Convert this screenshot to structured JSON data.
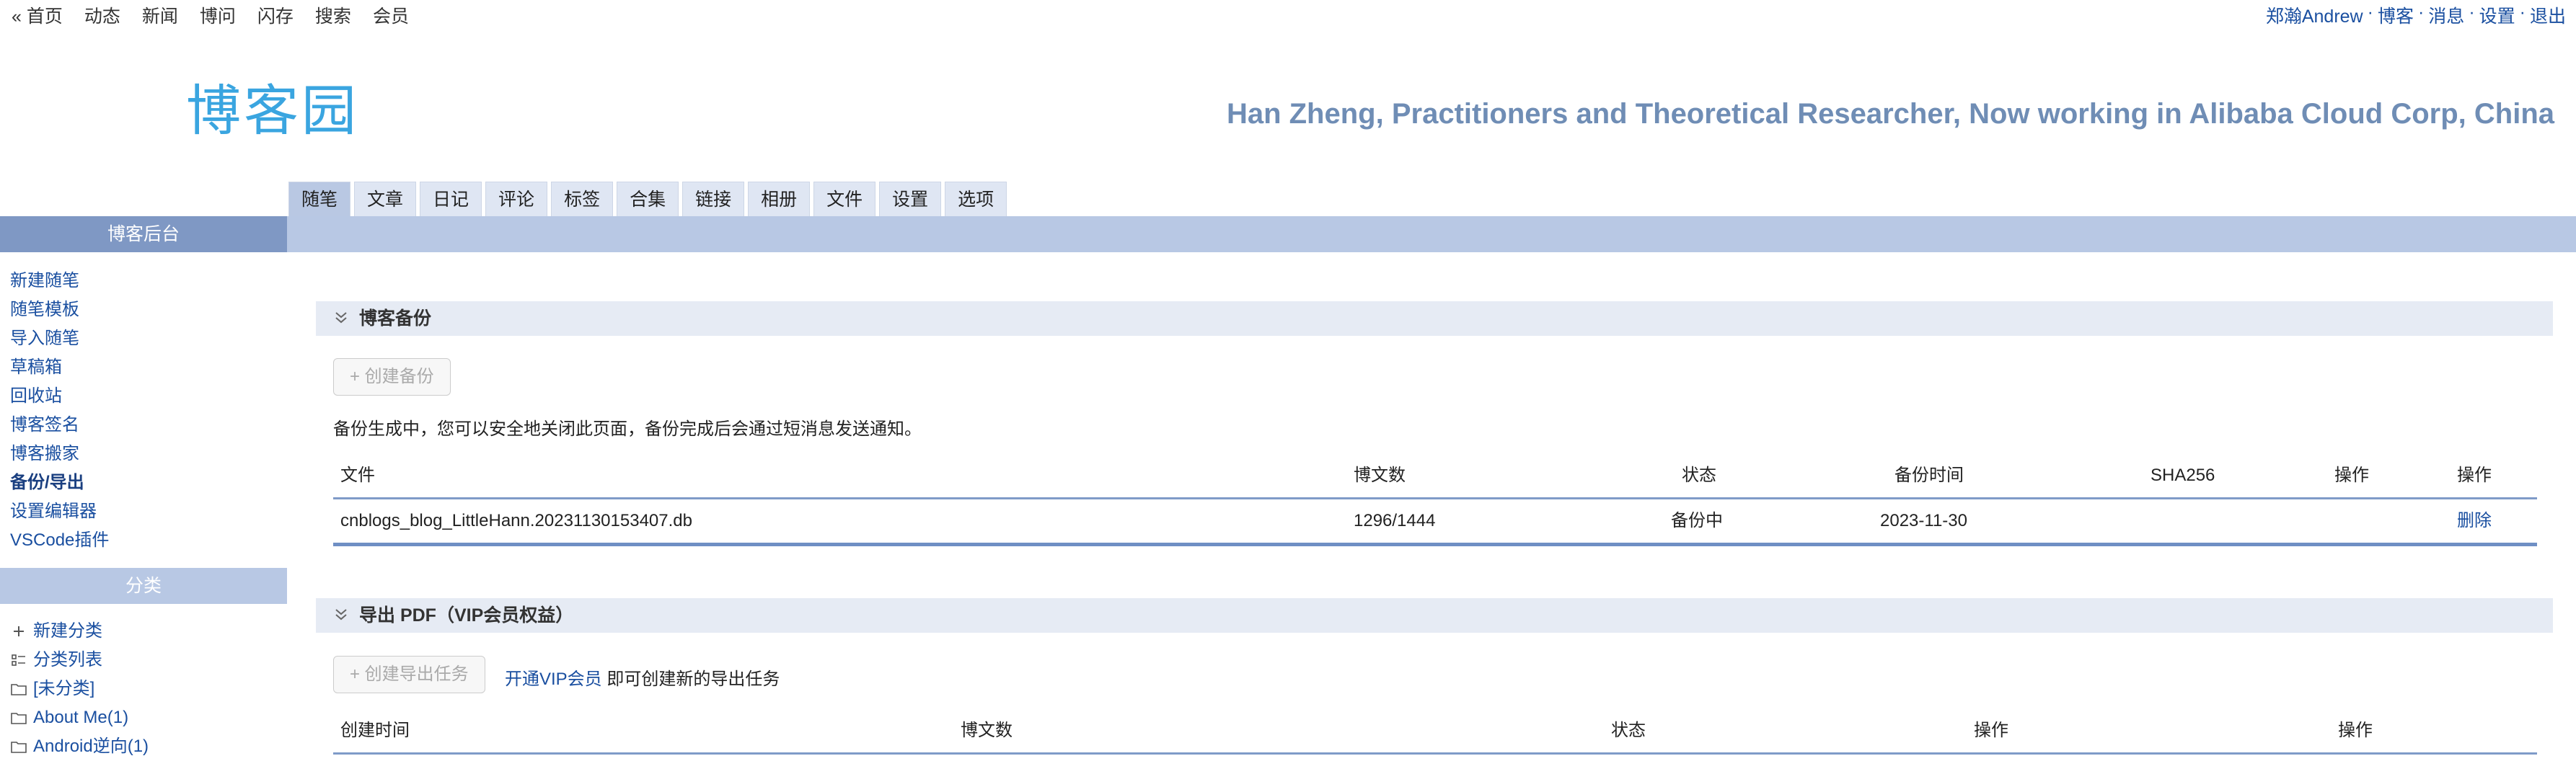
{
  "topnav": {
    "left": [
      "« 首页",
      "动态",
      "新闻",
      "博问",
      "闪存",
      "搜索",
      "会员"
    ],
    "right": [
      "郑瀚Andrew",
      "博客",
      "消息",
      "设置",
      "退出"
    ],
    "separator": "·"
  },
  "logo": {
    "text": "博客园",
    "color": "#3aa5e0"
  },
  "header": {
    "blog_title": "Han Zheng, Practitioners and Theoretical Researcher, Now working in Alibaba Cloud Corp, China"
  },
  "tabs": [
    "随笔",
    "文章",
    "日记",
    "评论",
    "标签",
    "合集",
    "链接",
    "相册",
    "文件",
    "设置",
    "选项"
  ],
  "sidebar": {
    "title": "博客后台",
    "items": [
      "新建随笔",
      "随笔模板",
      "导入随笔",
      "草稿箱",
      "回收站",
      "博客签名",
      "博客搬家",
      "备份/导出",
      "设置编辑器",
      "VSCode插件"
    ],
    "active_item": "备份/导出",
    "category_title": "分类",
    "categories": [
      {
        "icon": "plus-icon",
        "label": "新建分类"
      },
      {
        "icon": "list-icon",
        "label": "分类列表"
      },
      {
        "icon": "folder-icon",
        "label": "[未分类]"
      },
      {
        "icon": "folder-icon",
        "label": "About Me(1)"
      },
      {
        "icon": "folder-icon",
        "label": "Android逆向(1)"
      }
    ]
  },
  "backup": {
    "title": "博客备份",
    "create_button": "+ 创建备份",
    "message": "备份生成中，您可以安全地关闭此页面，备份完成后会通过短消息发送通知。",
    "columns": [
      "文件",
      "博文数",
      "状态",
      "备份时间",
      "SHA256",
      "操作",
      "操作"
    ],
    "rows": [
      {
        "file": "cnblogs_blog_LittleHann.20231130153407.db",
        "count": "1296/1444",
        "status": "备份中",
        "time": "2023-11-30",
        "sha256": "",
        "op1": "",
        "op2": "删除"
      }
    ]
  },
  "pdf": {
    "title": "导出 PDF（VIP会员权益）",
    "create_button": "+ 创建导出任务",
    "vip_link": "开通VIP会员",
    "vip_text": "即可创建新的导出任务",
    "columns": [
      "创建时间",
      "博文数",
      "状态",
      "操作",
      "操作"
    ]
  },
  "colors": {
    "nav_link": "#1a4fa0",
    "sidebar_header": "#7f98c4",
    "tab_bar": "#b8c8e4",
    "panel_header": "#e6ebf4",
    "blog_title": "#6f8db5"
  }
}
